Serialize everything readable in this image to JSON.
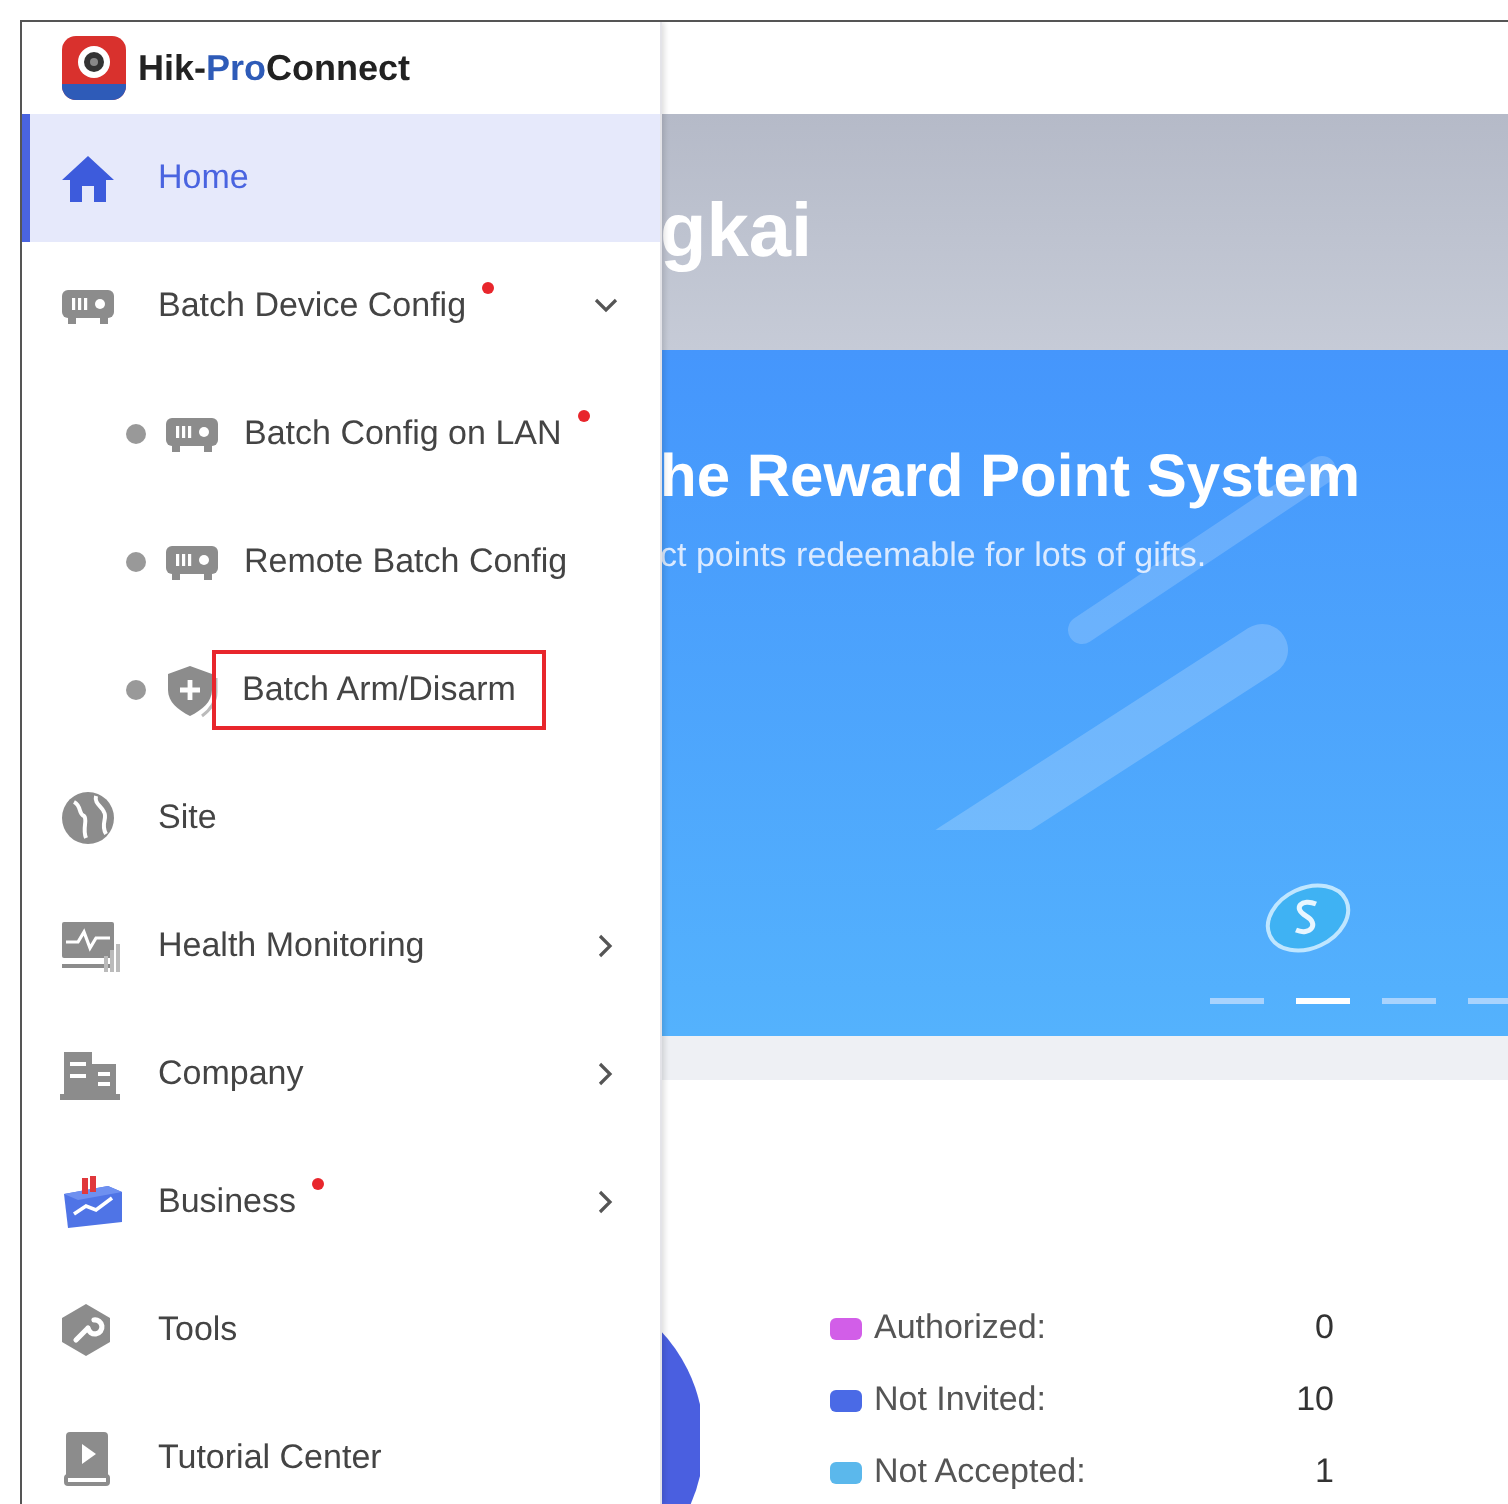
{
  "sidebar": {
    "app_name": [
      {
        "text": "Hik-",
        "accent": false
      },
      {
        "text": "Pro",
        "accent": true
      },
      {
        "text": "Connect",
        "accent": false
      }
    ],
    "items": [
      {
        "label": "Home",
        "selected": true,
        "badge_dot": false
      },
      {
        "label": "Batch Device Config",
        "selected": false,
        "badge_dot": true,
        "expanded": true,
        "children": [
          {
            "label": "Batch Config on LAN",
            "selected": false,
            "badge_dot": true,
            "highlighted": false
          },
          {
            "label": "Remote Batch Config",
            "selected": false,
            "badge_dot": false,
            "highlighted": false
          },
          {
            "label": "Batch Arm/Disarm",
            "selected": false,
            "badge_dot": false,
            "highlighted": true
          }
        ]
      },
      {
        "label": "Site",
        "selected": false,
        "badge_dot": false
      },
      {
        "label": "Health Monitoring",
        "selected": false,
        "badge_dot": false,
        "expanded": false
      },
      {
        "label": "Company",
        "selected": false,
        "badge_dot": false,
        "expanded": false
      },
      {
        "label": "Business",
        "selected": false,
        "badge_dot": true,
        "expanded": false
      },
      {
        "label": "Tools",
        "selected": false,
        "badge_dot": false
      },
      {
        "label": "Tutorial Center",
        "selected": false,
        "badge_dot": false
      }
    ]
  },
  "welcome": {
    "title": "gkai"
  },
  "banner": {
    "title": "he Reward Point System",
    "subtitle": "ct points redeemable for lots of gifts.",
    "slides": [
      {
        "selected": false
      },
      {
        "selected": true
      },
      {
        "selected": false
      },
      {
        "selected": false
      }
    ]
  },
  "legend": [
    {
      "label": "Authorized:",
      "value": "0",
      "color": "#d25ee8"
    },
    {
      "label": "Not Invited:",
      "value": "10",
      "color": "#4a6ae6"
    },
    {
      "label": "Not Accepted:",
      "value": "1",
      "color": "#5bb8ec"
    }
  ]
}
